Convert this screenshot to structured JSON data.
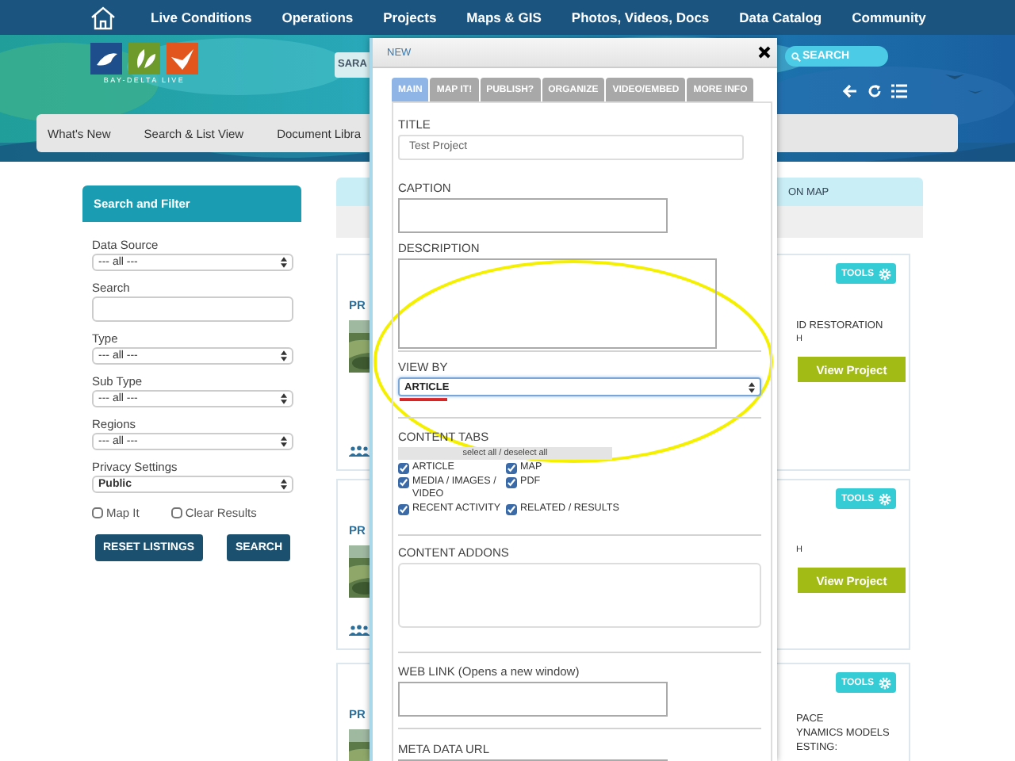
{
  "nav": {
    "items": [
      "Live Conditions",
      "Operations",
      "Projects",
      "Maps & GIS",
      "Photos, Videos, Docs",
      "Data Catalog",
      "Community"
    ]
  },
  "banner": {
    "logo_text": "BAY-DELTA LIVE",
    "search_field": {
      "value": "SARA"
    },
    "search_button": "SEARCH"
  },
  "subnav": {
    "items": [
      "What's New",
      "Search & List View",
      "Document Libra"
    ]
  },
  "sidebar": {
    "title": "Search and Filter",
    "fields": [
      {
        "label": "Data Source",
        "kind": "select",
        "value": "--- all ---"
      },
      {
        "label": "Search",
        "kind": "input"
      },
      {
        "label": "Type",
        "kind": "select",
        "value": "--- all ---"
      },
      {
        "label": "Sub Type",
        "kind": "select",
        "value": "--- all ---"
      },
      {
        "label": "Regions",
        "kind": "select",
        "value": "--- all ---"
      },
      {
        "label": "Privacy Settings",
        "kind": "select",
        "value": "Public"
      }
    ],
    "checkboxes": [
      {
        "label": "Map It",
        "checked": false
      },
      {
        "label": "Clear Results",
        "checked": false
      }
    ],
    "buttons": [
      "RESET LISTINGS",
      "SEARCH"
    ]
  },
  "results": {
    "header": "ON MAP",
    "cards": [
      {
        "title": "PR",
        "tools": "TOOLS",
        "lines": [
          "ID RESTORATION",
          "H"
        ],
        "button": "View Project"
      },
      {
        "title": "PR",
        "tools": "TOOLS",
        "lines": [
          "H"
        ],
        "button": "View Project"
      },
      {
        "title": "PR",
        "tools": "TOOLS",
        "lines": [
          "PACE",
          "YNAMICS MODELS",
          "ESTING:"
        ]
      }
    ]
  },
  "modal": {
    "title": "NEW",
    "tabs": [
      {
        "label": "MAIN",
        "selected": true
      },
      {
        "label": "MAP IT!",
        "selected": false
      },
      {
        "label": "PUBLISH?",
        "selected": false
      },
      {
        "label": "ORGANIZE",
        "selected": false
      },
      {
        "label": "VIDEO/EMBED",
        "selected": false
      },
      {
        "label": "MORE INFO",
        "selected": false
      }
    ],
    "groups": [
      [
        {
          "label": "TITLE",
          "kind": "input",
          "value": "Test Project"
        },
        {
          "label": "CAPTION",
          "kind": "textarea"
        },
        {
          "label": "DESCRIPTION",
          "kind": "large-textarea"
        }
      ],
      [
        {
          "label": "VIEW BY",
          "kind": "select",
          "value": "ARTICLE"
        }
      ],
      [
        {
          "label": "CONTENT TABS",
          "kind": "checkboxes",
          "toggle": "select all / deselect all",
          "options": [
            {
              "label": "ARTICLE",
              "checked": true
            },
            {
              "label": "MAP",
              "checked": true
            },
            {
              "label": "MEDIA / IMAGES / VIDEO",
              "checked": true
            },
            {
              "label": "PDF",
              "checked": true
            },
            {
              "label": "RECENT ACTIVITY",
              "checked": true
            },
            {
              "label": "RELATED / RESULTS",
              "checked": true
            }
          ]
        }
      ],
      [
        {
          "label": "CONTENT ADDONS",
          "kind": "list-box"
        }
      ],
      [
        {
          "label": "WEB LINK (Opens a new window)",
          "kind": "textarea"
        }
      ],
      [
        {
          "label": "META DATA URL",
          "kind": "textarea"
        }
      ]
    ]
  }
}
